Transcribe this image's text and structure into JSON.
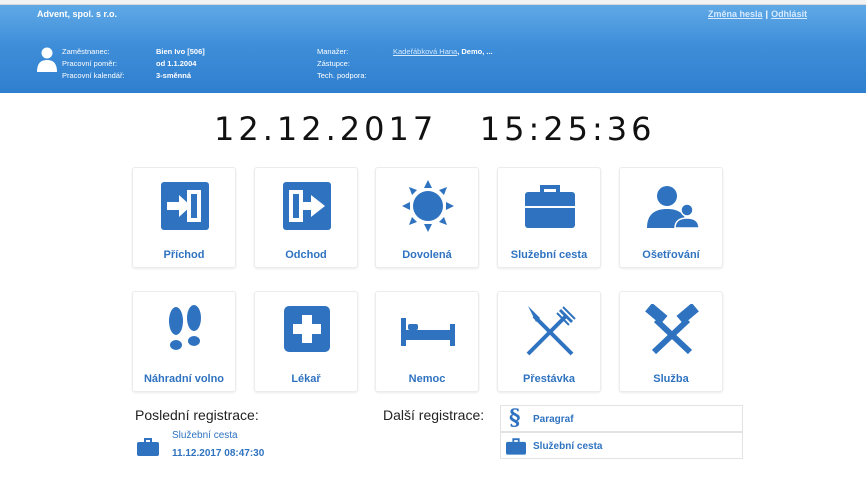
{
  "header": {
    "company": "Advent, spol. s r.o.",
    "links": {
      "change_password": "Změna hesla",
      "separator": "|",
      "logout": "Odhlásit"
    },
    "employee": {
      "labels": [
        "Zaměstnanec:",
        "Pracovní poměr:",
        "Pracovní kalendář:"
      ],
      "values": [
        "Bien Ivo [506]",
        "od 1.1.2004",
        "3-směnná"
      ]
    },
    "staff": {
      "labels": [
        "Manažer:",
        "Zástupce:",
        "Tech. podpora:"
      ],
      "manager_link": "Kadeřábková Hana",
      "manager_rest": ", Demo, ..."
    },
    "colors": {
      "header_top": "#5fa9e6",
      "header_bottom": "#2f7fcf",
      "accent": "#2f73c0"
    }
  },
  "clock": {
    "date": "12.12.2017",
    "time": "15:25:36"
  },
  "tiles": [
    {
      "label": "Příchod",
      "icon": "arrival-icon"
    },
    {
      "label": "Odchod",
      "icon": "departure-icon"
    },
    {
      "label": "Dovolená",
      "icon": "sun-icon"
    },
    {
      "label": "Služební cesta",
      "icon": "briefcase-icon"
    },
    {
      "label": "Ošetřování",
      "icon": "parent-child-icon"
    },
    {
      "label": "Náhradní volno",
      "icon": "footprints-icon"
    },
    {
      "label": "Lékař",
      "icon": "medical-cross-icon"
    },
    {
      "label": "Nemoc",
      "icon": "bed-icon"
    },
    {
      "label": "Přestávka",
      "icon": "fork-knife-icon"
    },
    {
      "label": "Služba",
      "icon": "crossed-hammers-icon"
    }
  ],
  "last_registration": {
    "title": "Poslední registrace:",
    "type": "Služební cesta",
    "datetime": "11.12.2017 08:47:30"
  },
  "next_registration": {
    "title": "Další registrace:",
    "items": [
      {
        "label": "Paragraf",
        "icon": "paragraph-icon"
      },
      {
        "label": "Služební cesta",
        "icon": "briefcase-icon"
      }
    ]
  }
}
